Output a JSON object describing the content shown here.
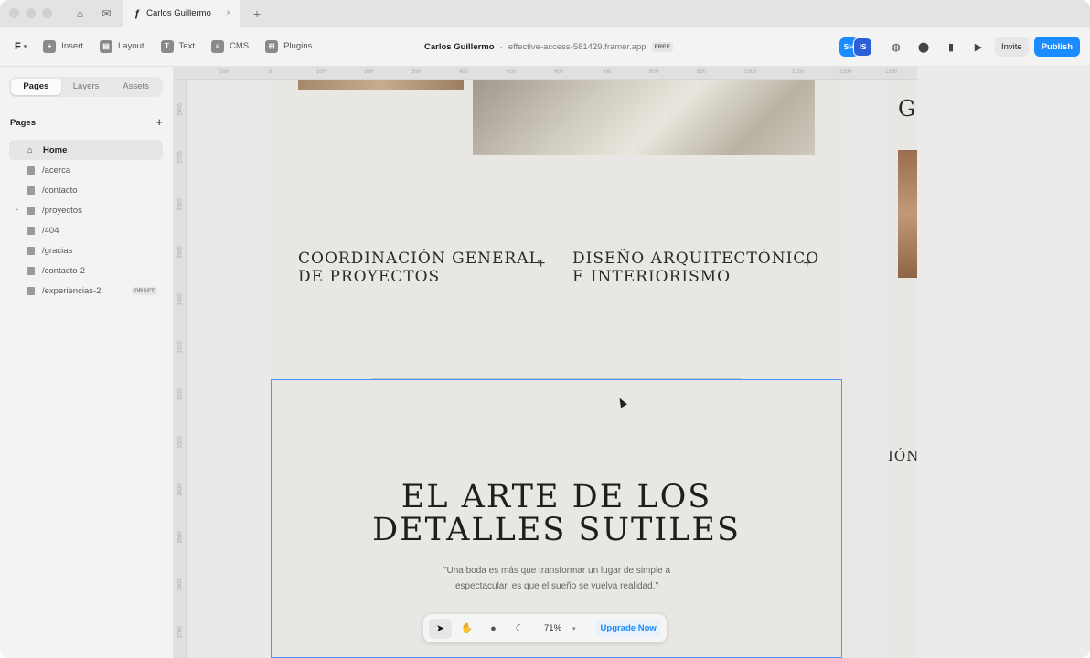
{
  "titlebar": {
    "tab_title": "Carlos Guillermo",
    "close_glyph": "×",
    "new_tab_glyph": "+"
  },
  "toolbar": {
    "logo_glyph": "F",
    "tools": [
      "Insert",
      "Layout",
      "Text",
      "CMS",
      "Plugins"
    ],
    "project_name": "Carlos Guillermo",
    "project_separator": "·",
    "project_domain": "effective-access-581429.framer.app",
    "plan_badge": "FREE",
    "avatars": [
      "SH",
      "IS"
    ],
    "invite_label": "Invite",
    "publish_label": "Publish"
  },
  "left_panel": {
    "tabs": [
      "Pages",
      "Layers",
      "Assets"
    ],
    "active_tab": "Pages",
    "section_title": "Pages",
    "add_glyph": "+",
    "pages": [
      {
        "label": "Home",
        "active": true,
        "draft": ""
      },
      {
        "label": "/acerca",
        "active": false,
        "draft": ""
      },
      {
        "label": "/contacto",
        "active": false,
        "draft": ""
      },
      {
        "label": "/proyectos",
        "active": false,
        "draft": ""
      },
      {
        "label": "/404",
        "active": false,
        "draft": ""
      },
      {
        "label": "/gracias",
        "active": false,
        "draft": ""
      },
      {
        "label": "/contacto-2",
        "active": false,
        "draft": ""
      },
      {
        "label": "/experiencias-2",
        "active": false,
        "draft": "DRAFT"
      }
    ]
  },
  "canvas": {
    "ruler_top": [
      "100",
      "0",
      "100",
      "200",
      "300",
      "400",
      "500",
      "600",
      "700",
      "800",
      "900",
      "1000",
      "1100",
      "1200",
      "1300"
    ],
    "ruler_left": [
      "2600",
      "2700",
      "2800",
      "2900",
      "3000",
      "3100",
      "3200",
      "3300",
      "3400",
      "3500",
      "3600",
      "3700"
    ],
    "services": [
      {
        "line1": "COORDINACIÓN GENERAL",
        "line2": "DE PROYECTOS",
        "plus": "+"
      },
      {
        "line1": "DISEÑO ARQUITECTÓNICO",
        "line2": "E INTERIORISMO",
        "plus": "+"
      }
    ],
    "section_title_line1": "EL ARTE DE LOS",
    "section_title_line2": "DETALLES SUTILES",
    "quote": "\"Una boda es más que transformar un lugar de simple a espectacular, es que el sueño se vuelva realidad.\"",
    "side_frame_letter": "G",
    "side_frame_text": "IÓN"
  },
  "bottom_bar": {
    "zoom_value": "71%",
    "upgrade_label": "Upgrade Now"
  }
}
